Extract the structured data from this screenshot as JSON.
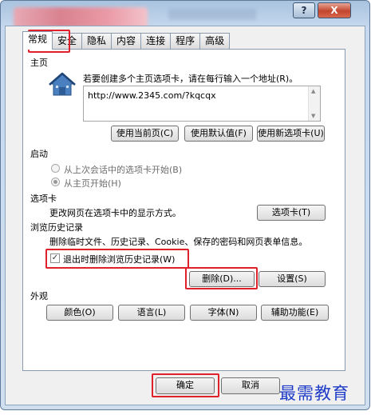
{
  "window": {
    "help_glyph": "?",
    "close_glyph": "X"
  },
  "tabs": [
    {
      "label": "常规",
      "active": true
    },
    {
      "label": "安全",
      "active": false
    },
    {
      "label": "隐私",
      "active": false
    },
    {
      "label": "内容",
      "active": false
    },
    {
      "label": "连接",
      "active": false
    },
    {
      "label": "程序",
      "active": false
    },
    {
      "label": "高级",
      "active": false
    }
  ],
  "homepage": {
    "section_title": "主页",
    "description": "若要创建多个主页选项卡，请在每行输入一个地址(R)。",
    "url": "http://www.2345.com/?kqcqx",
    "use_current_label": "使用当前页(C)",
    "use_default_label": "使用默认值(F)",
    "use_new_tab_label": "使用新选项卡(U)"
  },
  "startup": {
    "section_title": "启动",
    "option_last_session": "从上次会话中的选项卡开始(B)",
    "option_home": "从主页开始(H)",
    "selected": "option_home"
  },
  "tabs_section": {
    "section_title": "选项卡",
    "description": "更改网页在选项卡中的显示方式。",
    "button_label": "选项卡(T)"
  },
  "history": {
    "section_title": "浏览历史记录",
    "description": "删除临时文件、历史记录、Cookie、保存的密码和网页表单信息。",
    "checkbox_label": "退出时删除浏览历史记录(W)",
    "checkbox_checked": true,
    "delete_label": "删除(D)...",
    "settings_label": "设置(S)"
  },
  "appearance": {
    "section_title": "外观",
    "colors_label": "颜色(O)",
    "languages_label": "语言(L)",
    "fonts_label": "字体(N)",
    "accessibility_label": "辅助功能(E)"
  },
  "footer": {
    "ok_label": "确定",
    "cancel_label": "取消"
  },
  "watermark": "最需教育",
  "colors": {
    "highlight_box": "#e0202a",
    "watermark": "#1e3cc7"
  }
}
